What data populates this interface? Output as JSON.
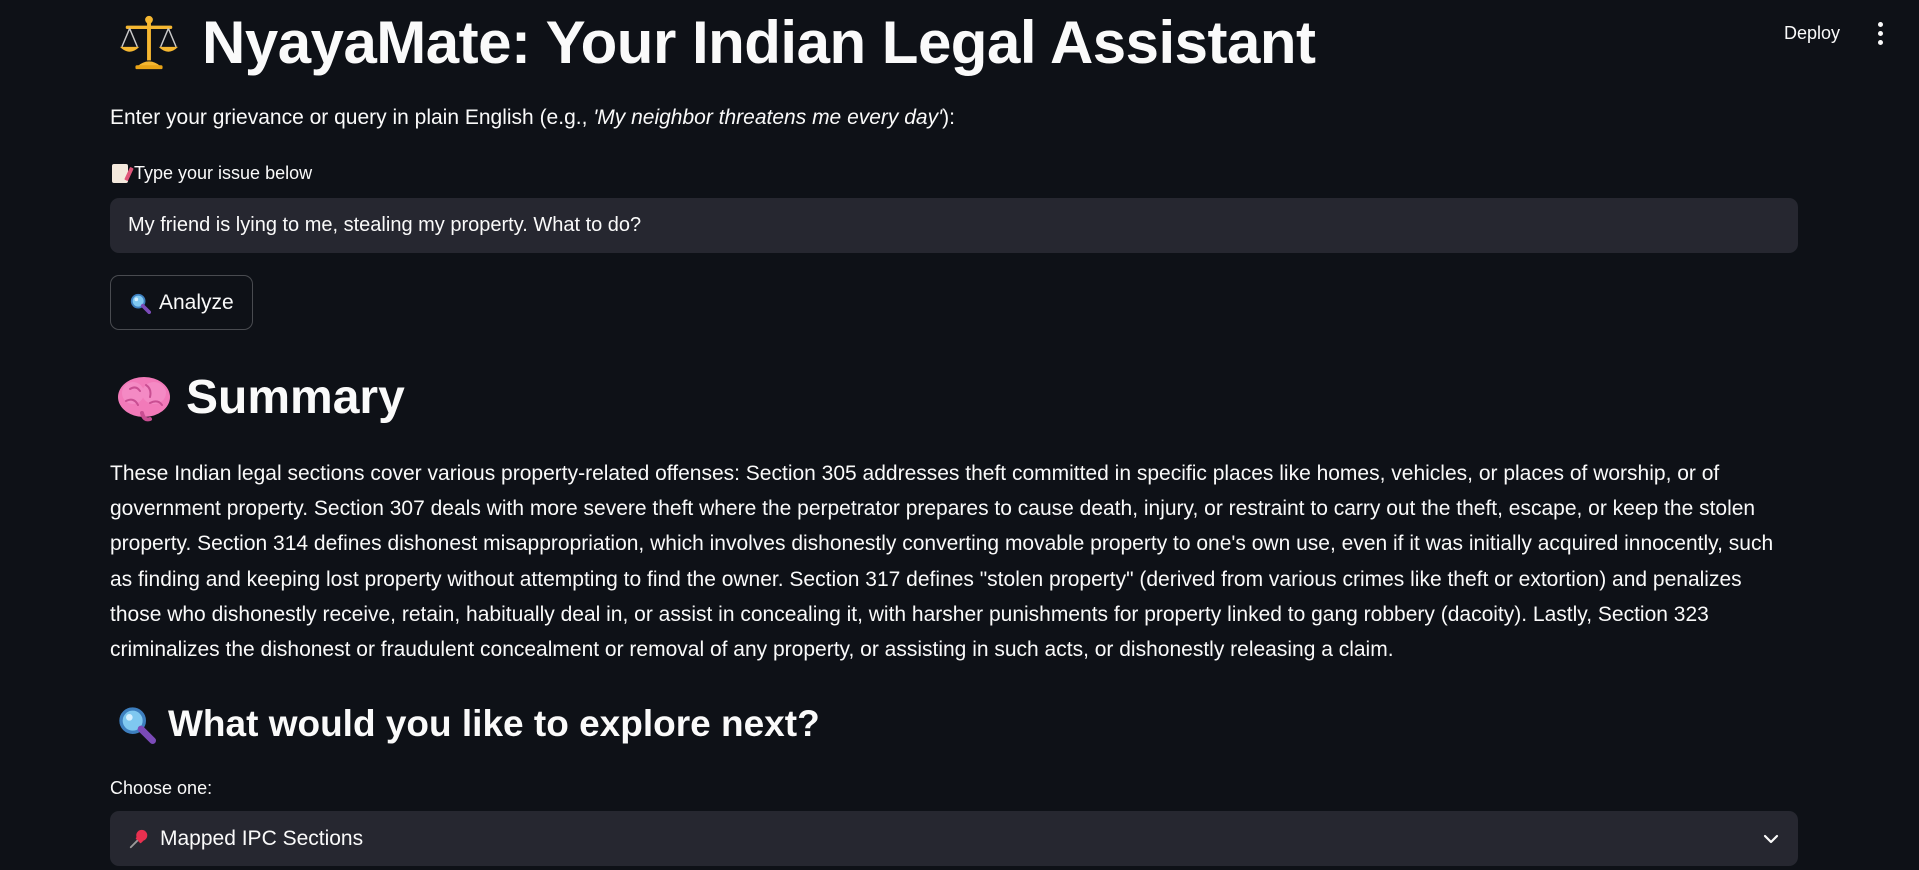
{
  "toolbar": {
    "deploy_label": "Deploy",
    "menu_icon": "kebab-menu-icon"
  },
  "header": {
    "title": "NyayaMate: Your Indian Legal Assistant",
    "title_icon": "balance-scale-icon"
  },
  "prompt": {
    "text_before": "Enter your grievance or query in plain English (e.g., ",
    "example": "'My neighbor threatens me every day'",
    "text_after": "):"
  },
  "issue_field": {
    "label": "Type your issue below",
    "label_icon": "memo-icon",
    "value": "My friend is lying to me, stealing my property. What to do?"
  },
  "analyze_button": {
    "label": "Analyze",
    "icon": "magnifying-glass-icon"
  },
  "summary": {
    "heading": "Summary",
    "heading_icon": "brain-icon",
    "text": "These Indian legal sections cover various property-related offenses: Section 305 addresses theft committed in specific places like homes, vehicles, or places of worship, or of government property. Section 307 deals with more severe theft where the perpetrator prepares to cause death, injury, or restraint to carry out the theft, escape, or keep the stolen property. Section 314 defines dishonest misappropriation, which involves dishonestly converting movable property to one's own use, even if it was initially acquired innocently, such as finding and keeping lost property without attempting to find the owner. Section 317 defines \"stolen property\" (derived from various crimes like theft or extortion) and penalizes those who dishonestly receive, retain, habitually deal in, or assist in concealing it, with harsher punishments for property linked to gang robbery (dacoity). Lastly, Section 323 criminalizes the dishonest or fraudulent concealment or removal of any property, or assisting in such acts, or dishonestly releasing a claim."
  },
  "explore": {
    "heading": "What would you like to explore next?",
    "heading_icon": "magnifying-glass-icon",
    "choose_label": "Choose one:",
    "selected": "Mapped IPC Sections",
    "selected_icon": "pushpin-icon"
  },
  "colors": {
    "background": "#0e1117",
    "input_bg": "#262730",
    "text": "#fafafa"
  }
}
